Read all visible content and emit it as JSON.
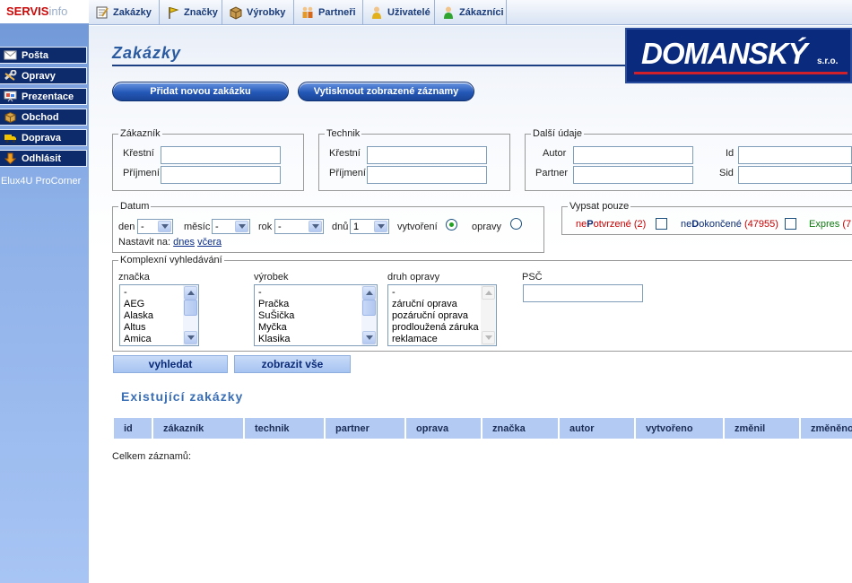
{
  "app": {
    "logo_main": "SERVIS",
    "logo_sub": "info"
  },
  "sidebar": {
    "items": [
      {
        "label": "Pošta",
        "icon": "mail-icon"
      },
      {
        "label": "Opravy",
        "icon": "wrench-icon"
      },
      {
        "label": "Prezentace",
        "icon": "presentation-icon"
      },
      {
        "label": "Obchod",
        "icon": "box-icon"
      },
      {
        "label": "Doprava",
        "icon": "truck-icon"
      },
      {
        "label": "Odhlásit",
        "icon": "logout-arrow-icon"
      }
    ],
    "footer": "Elux4U ProCorner"
  },
  "topmenu": {
    "items": [
      {
        "label": "Zakázky",
        "icon": "notepad-icon"
      },
      {
        "label": "Značky",
        "icon": "flag-icon"
      },
      {
        "label": "Výrobky",
        "icon": "box-icon"
      },
      {
        "label": "Partneři",
        "icon": "people-icon"
      },
      {
        "label": "Uživatelé",
        "icon": "user-icon"
      },
      {
        "label": "Zákazníci",
        "icon": "customer-icon"
      }
    ]
  },
  "main": {
    "title": "Zakázky",
    "brand": {
      "name": "DOMANSKÝ",
      "suffix": "s.r.o."
    },
    "add_button": "Přidat novou zakázku",
    "print_button": "Vytisknout zobrazené záznamy"
  },
  "customer": {
    "legend": "Zákazník",
    "first_label": "Křestní",
    "last_label": "Příjmení"
  },
  "technician": {
    "legend": "Technik",
    "first_label": "Křestní",
    "last_label": "Příjmení"
  },
  "other": {
    "legend": "Další údaje",
    "author_label": "Autor",
    "id_label": "Id",
    "partner_label": "Partner",
    "sid_label": "Sid"
  },
  "date": {
    "legend": "Datum",
    "day_label": "den",
    "day_value": "-",
    "month_label": "měsíc",
    "month_value": "-",
    "year_label": "rok",
    "year_value": "-",
    "days_label": "dnů",
    "days_value": "1",
    "created_label": "vytvoření",
    "repairs_label": "opravy",
    "set_label": "Nastavit na:",
    "today_link": "dnes",
    "yesterday_link": "včera"
  },
  "only": {
    "legend": "Vypsat pouze",
    "unconfirmed_pre": "ne",
    "unconfirmed_caps": "P",
    "unconfirmed_post": "otvrzené",
    "unconfirmed_count": "(2)",
    "unfinished_pre": "ne",
    "unfinished_caps": "D",
    "unfinished_post": "okončené",
    "unfinished_count": "(47955)",
    "express_label": "Expres",
    "express_count": "(7"
  },
  "complex": {
    "legend": "Komplexní vyhledávání",
    "brand_label": "značka",
    "brand_options": [
      "-",
      "AEG",
      "Alaska",
      "Altus",
      "Amica"
    ],
    "product_label": "výrobek",
    "product_options": [
      "-",
      "Pračka",
      "SuŠička",
      "Myčka",
      "Klasika"
    ],
    "repair_label": "druh opravy",
    "repair_options": [
      "-",
      "záruční oprava",
      "pozáruční oprava",
      "prodloužená záruka",
      "reklamace"
    ],
    "psc_label": "PSČ"
  },
  "search_button": "vyhledat",
  "show_all_button": "zobrazit vše",
  "existing": {
    "title": "Existující zakázky",
    "columns": [
      "id",
      "zákazník",
      "technik",
      "partner",
      "oprava",
      "značka",
      "autor",
      "vytvořeno",
      "změnil",
      "změněno"
    ],
    "total_label": "Celkem záznamů:"
  },
  "colors": {
    "sidebar_item": "#0d2a6b",
    "accent": "#2a5aa0",
    "brand_bg": "#0a2a7e",
    "brand_stripe": "#d2202a",
    "table_header": "#b3cbf3"
  }
}
